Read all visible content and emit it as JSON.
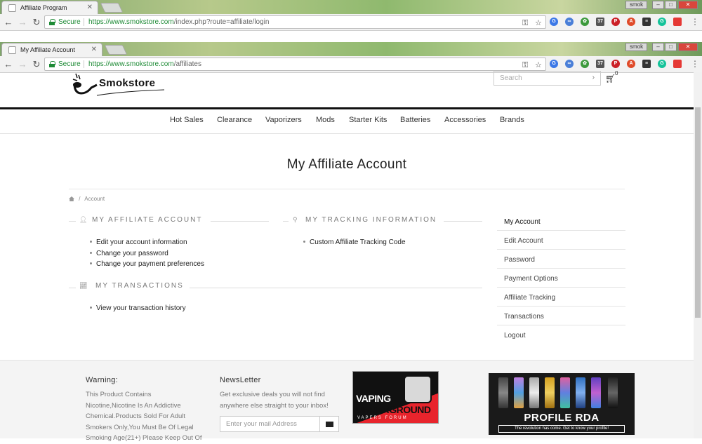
{
  "browser": {
    "back_window": {
      "tab_title": "Affiliate Program",
      "secure_label": "Secure",
      "url_host": "https://www.smokstore.com",
      "url_path": "/index.php?route=affiliate/login",
      "user": "smok"
    },
    "front_window": {
      "tab_title": "My Affiliate Account",
      "secure_label": "Secure",
      "url_host": "https://www.smokstore.com",
      "url_path": "/affiliates",
      "user": "smok"
    },
    "extension_icons": [
      "translate-icon",
      "link-icon",
      "leaf-icon",
      "badge-37-icon",
      "pinterest-icon",
      "adblock-icon",
      "layers-icon",
      "grammarly-icon",
      "red-square-icon"
    ],
    "badge_37": "37"
  },
  "header": {
    "logo_text": "Smokstore",
    "search_placeholder": "Search",
    "cart_count": "0"
  },
  "nav": {
    "items": [
      "Hot Sales",
      "Clearance",
      "Vaporizers",
      "Mods",
      "Starter Kits",
      "Batteries",
      "Accessories",
      "Brands"
    ]
  },
  "main": {
    "title": "My Affiliate Account",
    "breadcrumb": "Account",
    "affiliate_section": {
      "heading": "MY AFFILIATE ACCOUNT",
      "links": [
        "Edit your account information",
        "Change your password",
        "Change your payment preferences"
      ]
    },
    "tracking_section": {
      "heading": "MY TRACKING INFORMATION",
      "links": [
        "Custom Affiliate Tracking Code"
      ]
    },
    "transactions_section": {
      "heading": "MY TRANSACTIONS",
      "links": [
        "View your transaction history"
      ]
    }
  },
  "sidebar": {
    "items": [
      "My Account",
      "Edit Account",
      "Password",
      "Payment Options",
      "Affiliate Tracking",
      "Transactions",
      "Logout"
    ]
  },
  "footer": {
    "warning_heading": "Warning:",
    "warning_lines": [
      "This Product Contains",
      "Nicotine,Nicotine Is An Addictive",
      "Chemical.Products Sold For Adult",
      "Smokers Only,You Must Be Of Legal",
      "Smoking Age(21+) Please Keep Out Of"
    ],
    "newsletter_heading": "NewsLetter",
    "newsletter_lines": [
      "Get exclusive deals you will not find",
      "anywhere else straight to your inbox!"
    ],
    "newsletter_placeholder": "Enter your mail Address",
    "banner_vaping": {
      "line1": "VAPING",
      "line2": "UNDERGROUND",
      "line3": "VAPERS FORUM"
    },
    "banner_rda": {
      "title": "PROFILE RDA",
      "tagline": "The revolution has come. Get to know your profile!"
    }
  }
}
